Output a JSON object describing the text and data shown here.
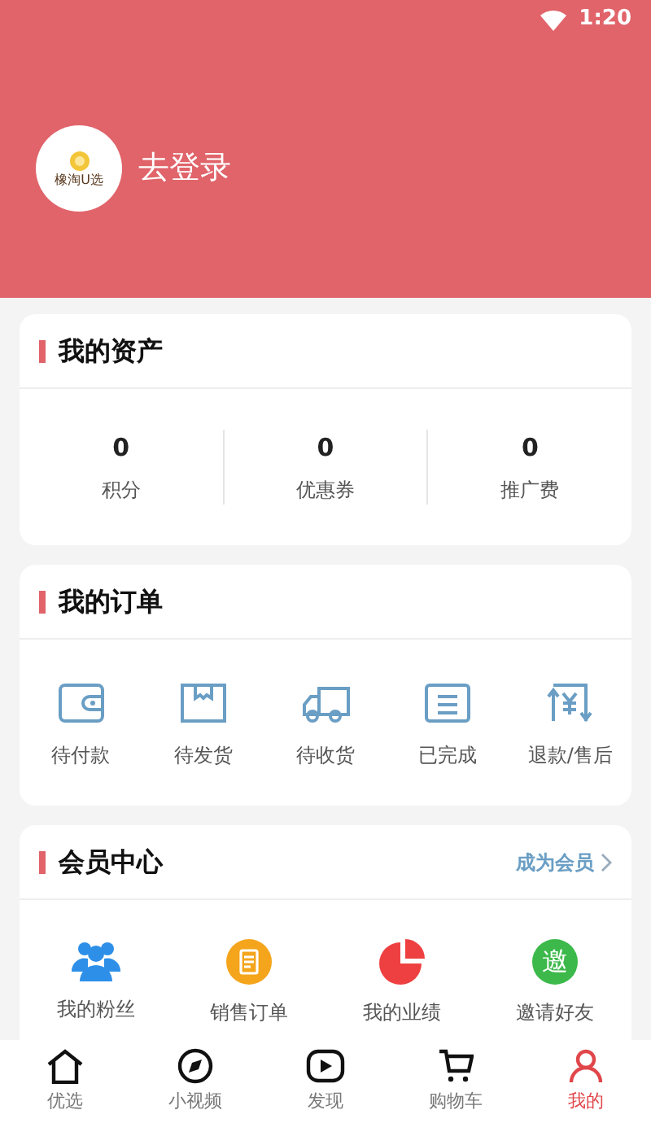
{
  "status_bar": {
    "time": "1:20"
  },
  "profile": {
    "logo_text": "橡淘U选",
    "login": "去登录"
  },
  "assets": {
    "title": "我的资产",
    "items": [
      {
        "value": "0",
        "label": "积分"
      },
      {
        "value": "0",
        "label": "优惠券"
      },
      {
        "value": "0",
        "label": "推广费"
      }
    ]
  },
  "orders": {
    "title": "我的订单",
    "items": [
      {
        "kind": "wallet",
        "label": "待付款"
      },
      {
        "kind": "box",
        "label": "待发货"
      },
      {
        "kind": "truck",
        "label": "待收货"
      },
      {
        "kind": "list",
        "label": "已完成"
      },
      {
        "kind": "refund",
        "label": "退款/售后"
      }
    ]
  },
  "member": {
    "title": "会员中心",
    "link": "成为会员",
    "items": [
      {
        "kind": "fans",
        "label": "我的粉丝",
        "color": "#2d8fe8"
      },
      {
        "kind": "sales",
        "label": "销售订单",
        "color": "#f4a51c"
      },
      {
        "kind": "chart",
        "label": "我的业绩",
        "color": "#ee4040"
      },
      {
        "kind": "invite",
        "glyph": "邀",
        "label": "邀请好友",
        "color": "#3cb94a"
      }
    ]
  },
  "tab_bar": [
    {
      "kind": "home",
      "label": "优选",
      "selected": false
    },
    {
      "kind": "compass",
      "label": "小视频",
      "selected": false
    },
    {
      "kind": "play",
      "label": "发现",
      "selected": false
    },
    {
      "kind": "cart",
      "label": "购物车",
      "selected": false
    },
    {
      "kind": "user",
      "label": "我的",
      "selected": true
    }
  ]
}
